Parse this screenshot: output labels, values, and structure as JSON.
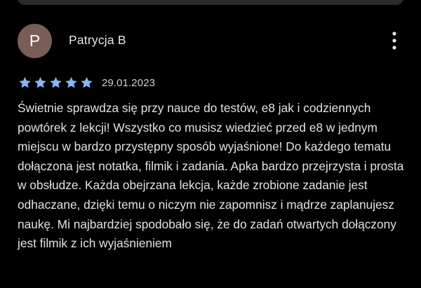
{
  "review": {
    "avatar_letter": "P",
    "author": "Patrycja B",
    "rating": 5,
    "rating_max": 5,
    "date": "29.01.2023",
    "text": "Świetnie sprawdza się przy nauce do testów, e8 jak i codziennych powtórek z lekcji! Wszystko co musisz wiedzieć przed e8 w jednym miejscu w bardzo przystępny sposób wyjaśnione! Do każdego tematu dołączona jest notatka, filmik i zadania. Apka bardzo przejrzysta i prosta w obsłudze. Każda obejrzana lekcja, każde zrobione zadanie jest odhaczane, dzięki temu o niczym nie zapomnisz i mądrze zaplanujesz naukę. Mi najbardziej spodobało się, że do zadań otwartych dołączony jest filmik z ich wyjaśnieniem"
  },
  "icons": {
    "more": "more-vert-icon",
    "star": "star-icon"
  },
  "colors": {
    "background": "#000000",
    "star": "#8ab4f8",
    "avatar": "#7a5d57",
    "text": "#e2e2e2"
  }
}
